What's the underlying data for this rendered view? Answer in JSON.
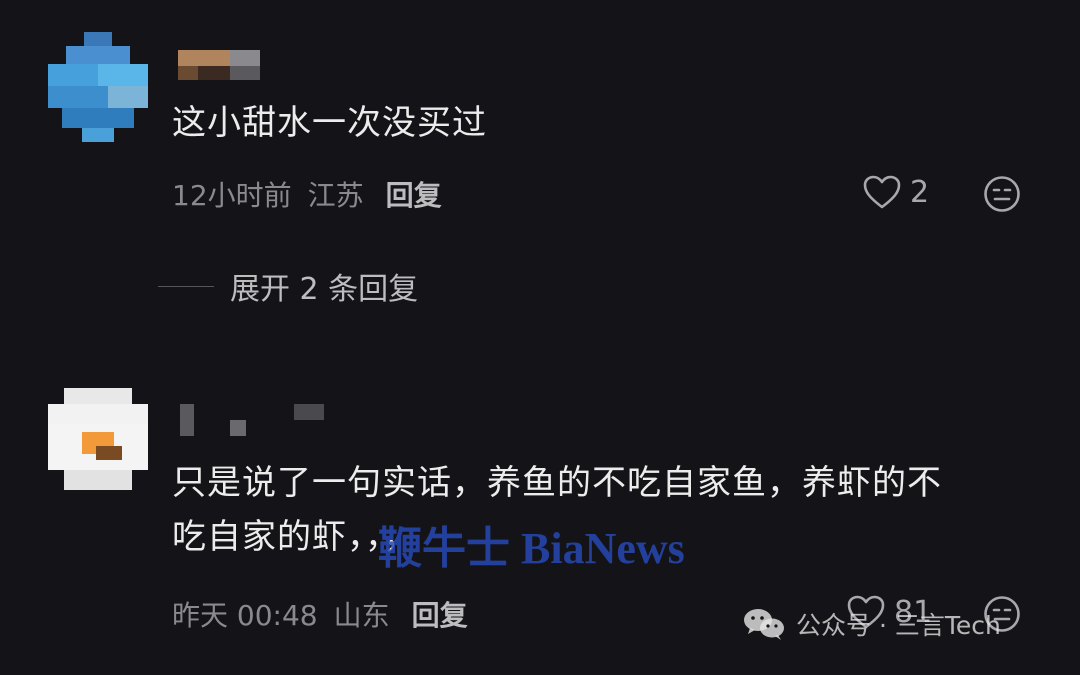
{
  "comments": [
    {
      "text": "这小甜水一次没买过",
      "time": "12小时前",
      "location": "江苏",
      "reply_label": "回复",
      "likes": "2",
      "expand_label": "展开 2 条回复"
    },
    {
      "text_line1": "只是说了一句实话，养鱼的不吃自家鱼，养虾的不",
      "text_line2": "吃自家的虾，，，",
      "time": "昨天 00:48",
      "location": "山东",
      "reply_label": "回复",
      "likes": "81"
    }
  ],
  "watermark": "鞭牛士 BiaNews",
  "source_tag": "公众号 · 三言Tech",
  "icons": {
    "like": "heart-outline-icon",
    "emoji": "neutral-face-icon",
    "wechat": "wechat-logo-icon"
  },
  "colors": {
    "background": "#141418",
    "text": "#ececec",
    "meta": "#8a8a8e",
    "watermark": "#2648b4"
  }
}
